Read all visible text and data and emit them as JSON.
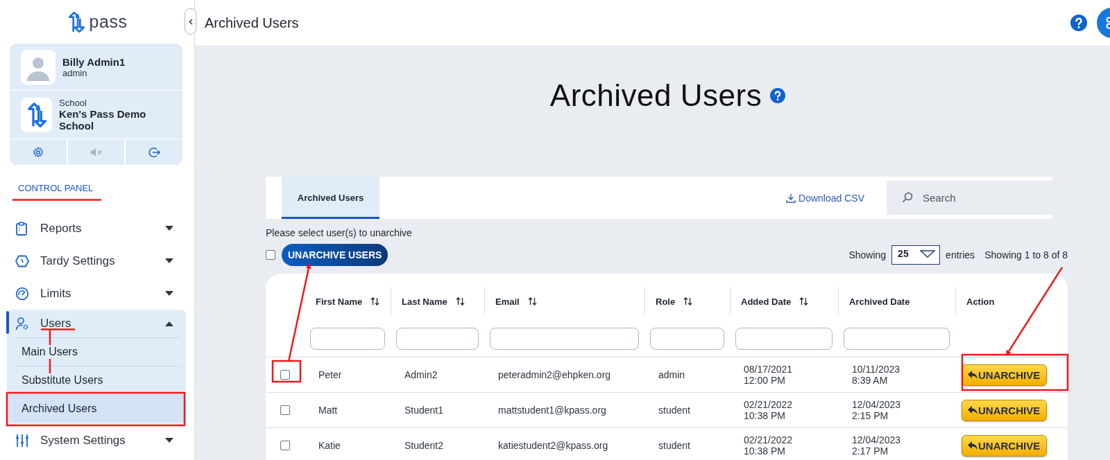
{
  "app": {
    "logo_text": "pass"
  },
  "topbar": {
    "title": "Archived Users"
  },
  "profile": {
    "name": "Billy Admin1",
    "role": "admin",
    "school_label": "School",
    "school_name": "Ken's Pass Demo School"
  },
  "control_panel_label": "CONTROL PANEL",
  "nav": [
    {
      "label": "Reports",
      "kind": "clipboard",
      "expanded": false
    },
    {
      "label": "Tardy Settings",
      "kind": "hexagon",
      "expanded": false
    },
    {
      "label": "Limits",
      "kind": "gauge",
      "expanded": false
    },
    {
      "label": "Users",
      "kind": "user",
      "expanded": true,
      "children": [
        {
          "label": "Main Users",
          "selected": false
        },
        {
          "label": "Substitute Users",
          "selected": false
        },
        {
          "label": "Archived Users",
          "selected": true
        }
      ]
    },
    {
      "label": "System Settings",
      "kind": "sliders",
      "expanded": false
    }
  ],
  "page": {
    "heading": "Archived Users"
  },
  "tabs": [
    {
      "label": "Archived Users",
      "selected": true
    }
  ],
  "download_label": "Download CSV",
  "search": {
    "placeholder": "Search"
  },
  "instruction": "Please select user(s) to unarchive",
  "select_all": {
    "checked": false
  },
  "bulk_button": "UNARCHIVE USERS",
  "page_size": {
    "label_before": "Showing",
    "value": "25",
    "label_after": "entries"
  },
  "summary": "Showing 1 to 8 of 8",
  "table": {
    "columns": [
      {
        "label": "First Name",
        "sortable": true,
        "filterable": true
      },
      {
        "label": "Last Name",
        "sortable": true,
        "filterable": true
      },
      {
        "label": "Email",
        "sortable": true,
        "filterable": true
      },
      {
        "label": "Role",
        "sortable": true,
        "filterable": true
      },
      {
        "label": "Added Date",
        "sortable": true,
        "filterable": true
      },
      {
        "label": "Archived Date",
        "sortable": false,
        "filterable": true
      },
      {
        "label": "Action",
        "sortable": false,
        "filterable": false
      }
    ],
    "rows": [
      {
        "checked": false,
        "cells": [
          "Peter",
          "Admin2",
          "peteradmin2@ehpken.org",
          "admin",
          "08/17/2021\n12:00 PM",
          "10/11/2023\n8:39 AM"
        ],
        "action": "UNARCHIVE"
      },
      {
        "checked": false,
        "cells": [
          "Matt",
          "Student1",
          "mattstudent1@kpass.org",
          "student",
          "02/21/2022\n10:38 PM",
          "12/04/2023\n2:15 PM"
        ],
        "action": "UNARCHIVE"
      },
      {
        "checked": false,
        "cells": [
          "Katie",
          "Student2",
          "katiestudent2@kpass.org",
          "student",
          "02/21/2022\n10:38 PM",
          "12/04/2023\n2:17 PM"
        ],
        "action": "UNARCHIVE"
      }
    ]
  }
}
